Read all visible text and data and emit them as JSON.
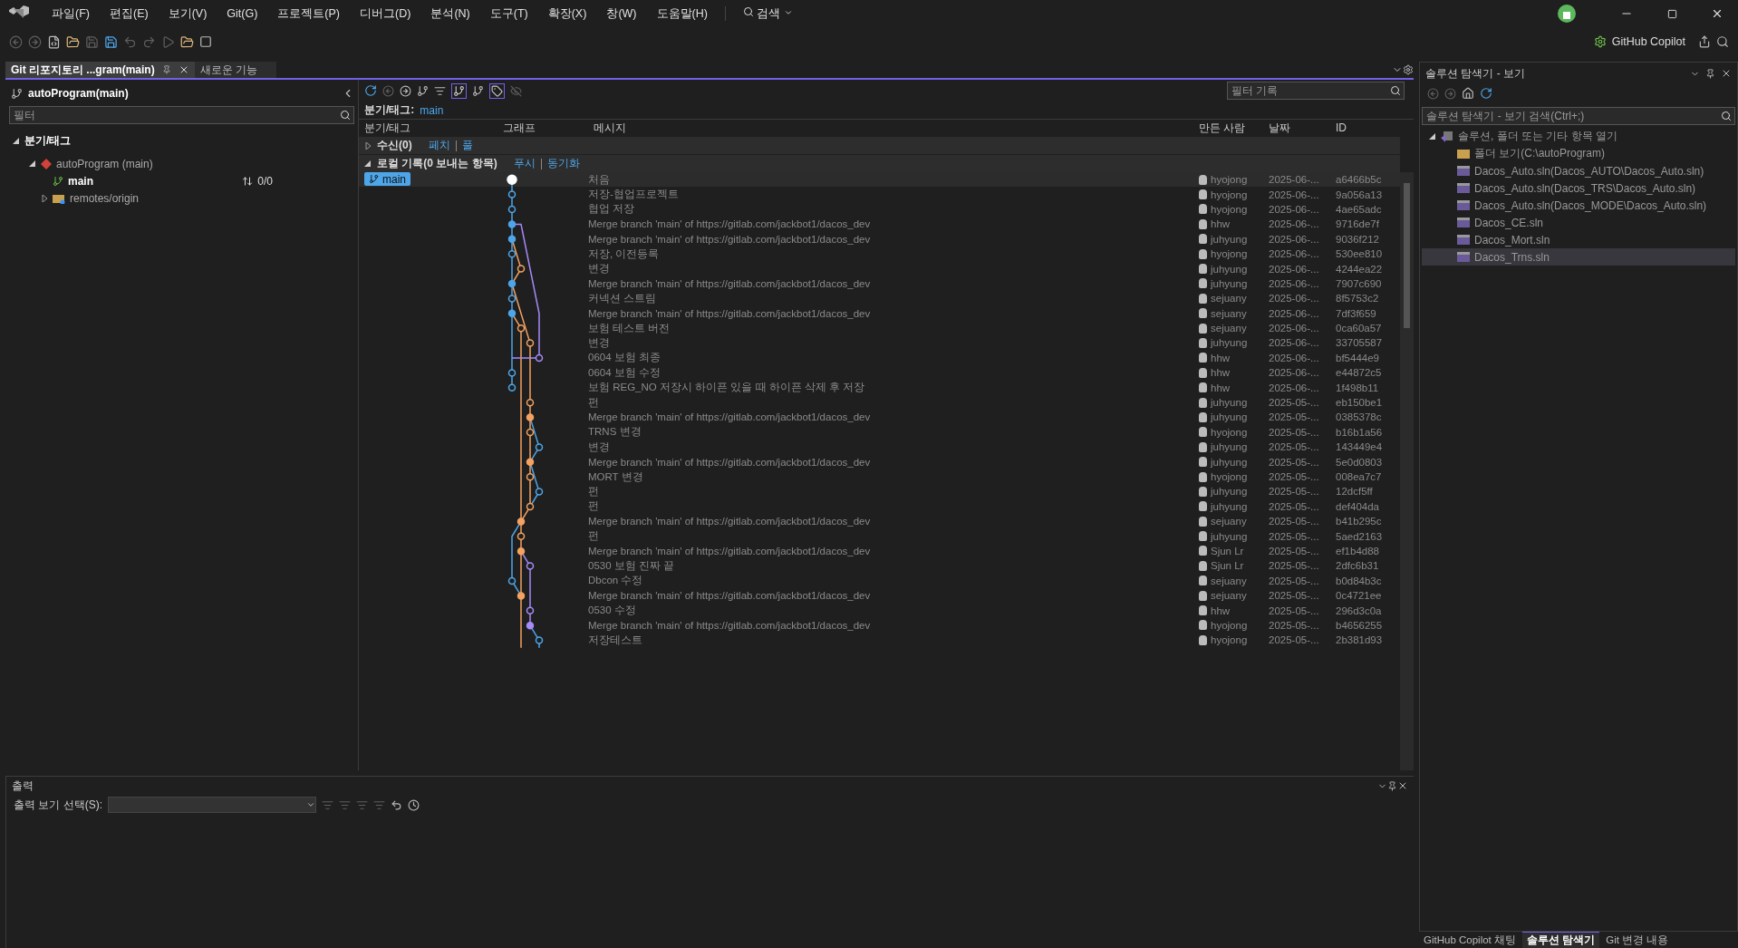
{
  "menu": [
    "파일(F)",
    "편집(E)",
    "보기(V)",
    "Git(G)",
    "프로젝트(P)",
    "디버그(D)",
    "분석(N)",
    "도구(T)",
    "확장(X)",
    "창(W)",
    "도움말(H)"
  ],
  "search": {
    "label": "검색"
  },
  "copilot": {
    "label": "GitHub Copilot"
  },
  "doc_tabs": [
    {
      "label": "Git 리포지토리 ...gram(main)",
      "selected": true
    },
    {
      "label": "새로운 기능",
      "selected": false
    }
  ],
  "branches_panel": {
    "title": "autoProgram(main)",
    "filter": {
      "placeholder": "필터"
    },
    "section": {
      "label": "분기/태그",
      "expanded": true
    },
    "tree": [
      {
        "label": "autoProgram (main)",
        "kind": "repo",
        "expanded": true,
        "children": [
          {
            "label": "main",
            "kind": "branch",
            "sync": "0/0"
          },
          {
            "label": "remotes/origin",
            "kind": "remote",
            "expanded": false
          }
        ]
      }
    ]
  },
  "history": {
    "filter": {
      "placeholder": "필터 기록"
    },
    "branch_label": "분기/태그:",
    "branch": "main",
    "columns": [
      "분기/태그",
      "그래프",
      "메시지",
      "만든 사람",
      "날짜",
      "ID"
    ],
    "incoming": {
      "label": "수신(0)",
      "expanded": false,
      "links": [
        "페치",
        "풀"
      ]
    },
    "outgoing": {
      "label": "로컬 기록(0 보내는 항목)",
      "expanded": true,
      "links": [
        "푸시",
        "동기화"
      ]
    },
    "rows": [
      {
        "branch": "main",
        "message": "처음",
        "author": "hyojong",
        "date": "2025-06-...",
        "id": "a6466b5c",
        "selected": true
      },
      {
        "message": "저장-협업프로젝트",
        "author": "hyojong",
        "date": "2025-06-...",
        "id": "9a056a13",
        "selected": false
      },
      {
        "message": "협업 저장",
        "author": "hyojong",
        "date": "2025-06-...",
        "id": "4ae65adc",
        "selected": false
      },
      {
        "message": "Merge branch 'main' of https://gitlab.com/jackbot1/dacos_dev",
        "author": "hhw",
        "date": "2025-06-...",
        "id": "9716de7f",
        "selected": false
      },
      {
        "message": "Merge branch 'main' of https://gitlab.com/jackbot1/dacos_dev",
        "author": "juhyung",
        "date": "2025-06-...",
        "id": "9036f212",
        "selected": false
      },
      {
        "message": "저장, 이전등록",
        "author": "hyojong",
        "date": "2025-06-...",
        "id": "530ee810",
        "selected": false
      },
      {
        "message": "변경",
        "author": "juhyung",
        "date": "2025-06-...",
        "id": "4244ea22",
        "selected": false
      },
      {
        "message": "Merge branch 'main' of https://gitlab.com/jackbot1/dacos_dev",
        "author": "juhyung",
        "date": "2025-06-...",
        "id": "7907c690",
        "selected": false
      },
      {
        "message": "커넥션 스트림",
        "author": "sejuany",
        "date": "2025-06-...",
        "id": "8f5753c2",
        "selected": false
      },
      {
        "message": "Merge branch 'main' of https://gitlab.com/jackbot1/dacos_dev",
        "author": "sejuany",
        "date": "2025-06-...",
        "id": "7df3f659",
        "selected": false
      },
      {
        "message": "보험 테스트 버전",
        "author": "sejuany",
        "date": "2025-06-...",
        "id": "0ca60a57",
        "selected": false
      },
      {
        "message": "변경",
        "author": "juhyung",
        "date": "2025-06-...",
        "id": "33705587",
        "selected": false
      },
      {
        "message": "0604 보험 최종",
        "author": "hhw",
        "date": "2025-06-...",
        "id": "bf5444e9",
        "selected": false
      },
      {
        "message": "0604 보험 수정",
        "author": "hhw",
        "date": "2025-06-...",
        "id": "e44872c5",
        "selected": false
      },
      {
        "message": "보험 REG_NO 저장시 하이픈 있을 때 하이픈 삭제 후 저장",
        "author": "hhw",
        "date": "2025-06-...",
        "id": "1f498b11",
        "selected": false
      },
      {
        "message": "펀",
        "author": "juhyung",
        "date": "2025-05-...",
        "id": "eb150be1",
        "selected": false
      },
      {
        "message": "Merge branch 'main' of https://gitlab.com/jackbot1/dacos_dev",
        "author": "juhyung",
        "date": "2025-05-...",
        "id": "0385378c",
        "selected": false
      },
      {
        "message": "TRNS 변경",
        "author": "hyojong",
        "date": "2025-05-...",
        "id": "b16b1a56",
        "selected": false
      },
      {
        "message": "변경",
        "author": "juhyung",
        "date": "2025-05-...",
        "id": "143449e4",
        "selected": false
      },
      {
        "message": "Merge branch 'main' of https://gitlab.com/jackbot1/dacos_dev",
        "author": "juhyung",
        "date": "2025-05-...",
        "id": "5e0d0803",
        "selected": false
      },
      {
        "message": "MORT 변경",
        "author": "hyojong",
        "date": "2025-05-...",
        "id": "008ea7c7",
        "selected": false
      },
      {
        "message": "펀",
        "author": "juhyung",
        "date": "2025-05-...",
        "id": "12dcf5ff",
        "selected": false
      },
      {
        "message": "펀",
        "author": "juhyung",
        "date": "2025-05-...",
        "id": "def404da",
        "selected": false
      },
      {
        "message": "Merge branch 'main' of https://gitlab.com/jackbot1/dacos_dev",
        "author": "sejuany",
        "date": "2025-05-...",
        "id": "b41b295c",
        "selected": false
      },
      {
        "message": "펀",
        "author": "juhyung",
        "date": "2025-05-...",
        "id": "5aed2163",
        "selected": false
      },
      {
        "message": "Merge branch 'main' of https://gitlab.com/jackbot1/dacos_dev",
        "author": "Sjun Lr",
        "date": "2025-05-...",
        "id": "ef1b4d88",
        "selected": false
      },
      {
        "message": "0530 보험 진짜 끝",
        "author": "Sjun Lr",
        "date": "2025-05-...",
        "id": "2dfc6b31",
        "selected": false
      },
      {
        "message": "Dbcon 수정",
        "author": "sejuany",
        "date": "2025-05-...",
        "id": "b0d84b3c",
        "selected": false
      },
      {
        "message": "Merge branch 'main' of https://gitlab.com/jackbot1/dacos_dev",
        "author": "sejuany",
        "date": "2025-05-...",
        "id": "0c4721ee",
        "selected": false
      },
      {
        "message": "0530 수정",
        "author": "hhw",
        "date": "2025-05-...",
        "id": "296d3c0a",
        "selected": false
      },
      {
        "message": "Merge branch 'main' of https://gitlab.com/jackbot1/dacos_dev",
        "author": "hyojong",
        "date": "2025-05-...",
        "id": "b4656255",
        "selected": false
      },
      {
        "message": "저장테스트",
        "author": "hyojong",
        "date": "2025-05-...",
        "id": "2b381d93",
        "selected": false
      }
    ]
  },
  "output": {
    "title": "출력",
    "select_label": "출력 보기 선택(S):"
  },
  "solution_explorer": {
    "title": "솔루션 탐색기 - 보기",
    "search": {
      "placeholder": "솔루션 탐색기 - 보기 검색(Ctrl+;)"
    },
    "tree": [
      {
        "label": "솔루션, 폴더 또는 기타 항목 열기",
        "kind": "root",
        "expanded": true,
        "selected": false,
        "children": [
          {
            "label": "폴더 보기(C:\\autoProgram)",
            "kind": "folder",
            "selected": false
          },
          {
            "label": "Dacos_Auto.sln(Dacos_AUTO\\Dacos_Auto.sln)",
            "kind": "solution",
            "selected": false
          },
          {
            "label": "Dacos_Auto.sln(Dacos_TRS\\Dacos_Auto.sln)",
            "kind": "solution",
            "selected": false
          },
          {
            "label": "Dacos_Auto.sln(Dacos_MODE\\Dacos_Auto.sln)",
            "kind": "solution",
            "selected": false
          },
          {
            "label": "Dacos_CE.sln",
            "kind": "solution",
            "selected": false
          },
          {
            "label": "Dacos_Mort.sln",
            "kind": "solution",
            "selected": false
          },
          {
            "label": "Dacos_Trns.sln",
            "kind": "solution",
            "selected": true
          }
        ]
      }
    ]
  },
  "bottom_tabs": [
    {
      "label": "GitHub Copilot 채팅",
      "selected": false
    },
    {
      "label": "솔루션 탐색기",
      "selected": true
    },
    {
      "label": "Git 변경 내용",
      "selected": false
    }
  ]
}
